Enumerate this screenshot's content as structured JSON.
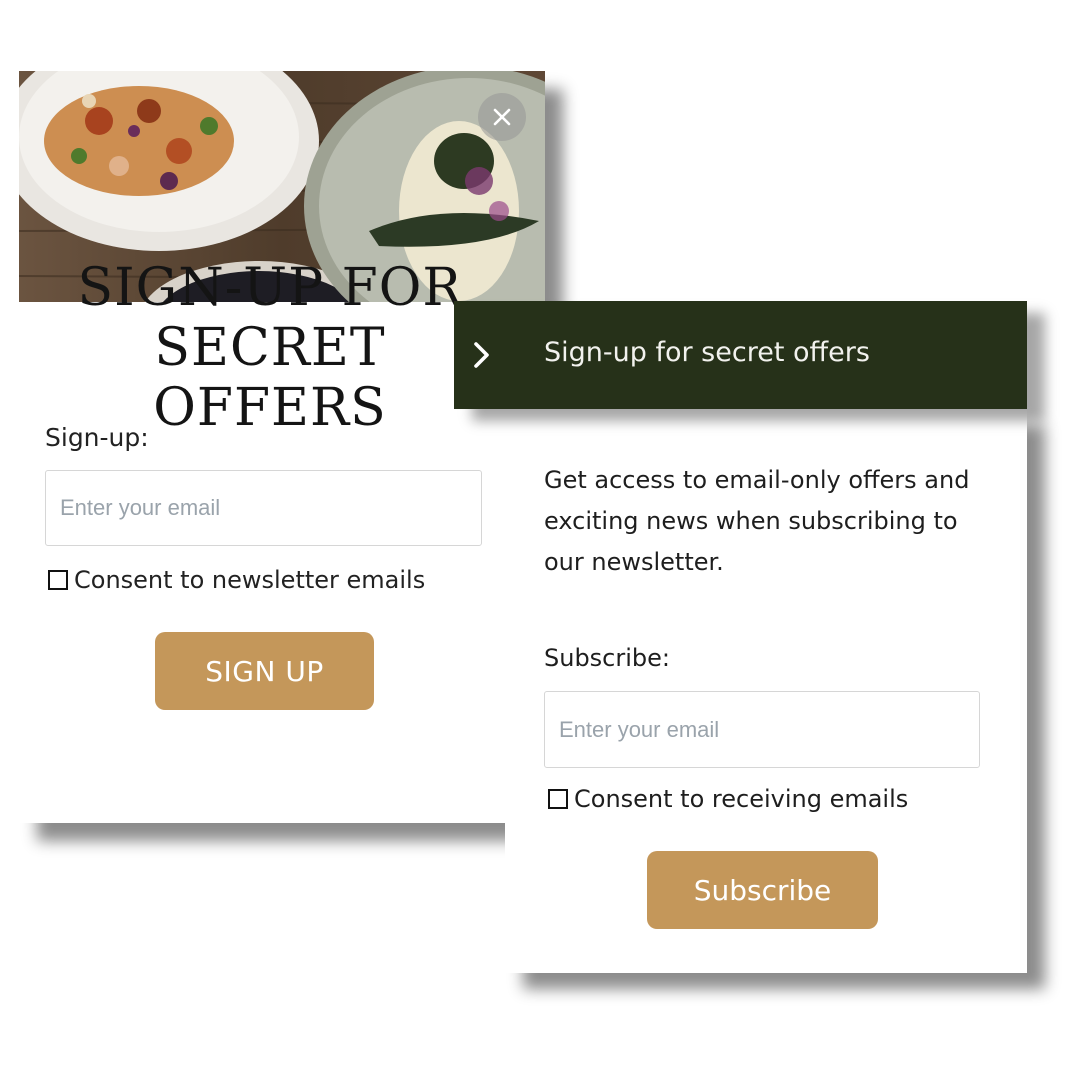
{
  "left_popup": {
    "title_line1": "SIGN-UP FOR",
    "title_line2": "SECRET OFFERS",
    "label": "Sign-up:",
    "email_placeholder": "Enter your email",
    "email_value": "",
    "consent_label": "Consent to newsletter emails",
    "consent_checked": false,
    "button_label": "SIGN UP",
    "close_icon": "close-icon",
    "hero_image": "food-plates-photo"
  },
  "right_panel": {
    "header_title": "Sign-up for secret offers",
    "header_icon": "chevron-right-icon",
    "description": "Get access to email-only offers and exciting news when subscribing to our newsletter.",
    "label": "Subscribe:",
    "email_placeholder": "Enter your email",
    "email_value": "",
    "consent_label": "Consent to receiving emails",
    "consent_checked": false,
    "button_label": "Subscribe"
  },
  "colors": {
    "accent_button": "#c4975a",
    "header_background": "#263119",
    "header_text": "#f2f2ee",
    "placeholder_text": "#9aa3ab"
  }
}
